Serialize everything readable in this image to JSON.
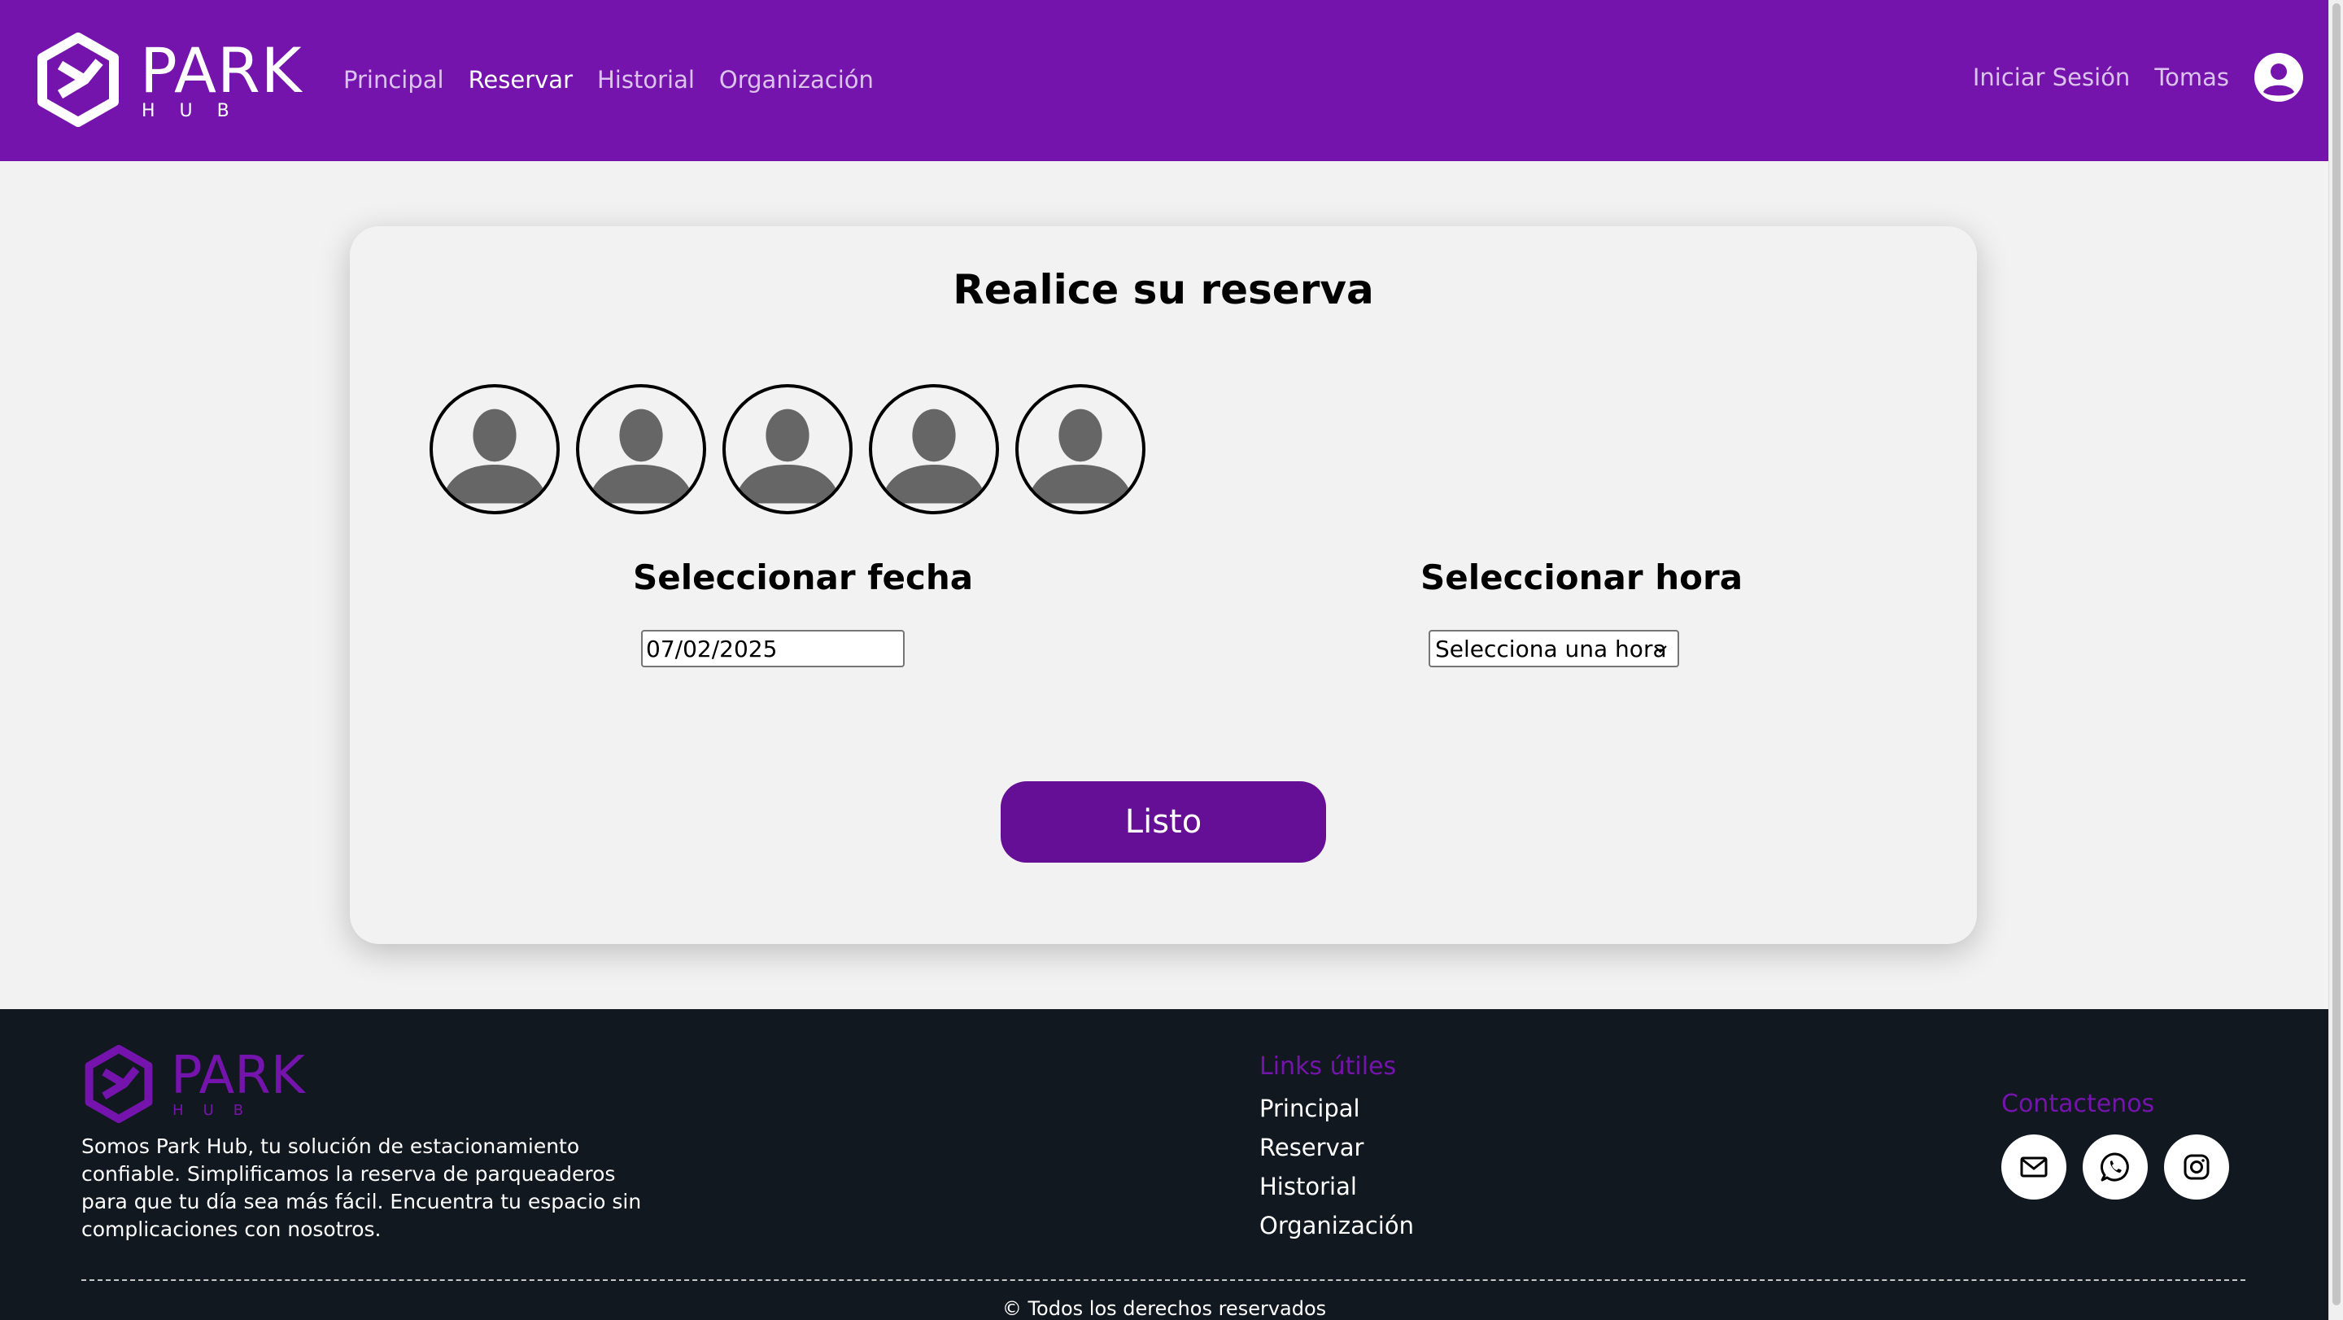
{
  "header": {
    "logo_word": "PARK",
    "logo_sub": "HUB",
    "nav": [
      {
        "label": "Principal",
        "active": false
      },
      {
        "label": "Reservar",
        "active": true
      },
      {
        "label": "Historial",
        "active": false
      },
      {
        "label": "Organización",
        "active": false
      }
    ],
    "login_label": "Iniciar Sesión",
    "user_name": "Tomas",
    "user_icon": "account-circle-icon"
  },
  "colors": {
    "brand": "#7514ac",
    "button": "#650f96",
    "footer_bg": "#111820",
    "page_bg": "#f2f2f2"
  },
  "reservation": {
    "title": "Realice su reserva",
    "avatar_icon": "person-placeholder-icon",
    "avatar_count": 5,
    "date_label": "Seleccionar fecha",
    "date_value": "07/02/2025",
    "time_label": "Seleccionar hora",
    "time_value": "Selecciona una hora",
    "submit_label": "Listo"
  },
  "footer": {
    "logo_word": "PARK",
    "logo_sub": "HUB",
    "description": "Somos Park Hub, tu solución de estacionamiento confiable. Simplificamos la reserva de parqueaderos para que tu día sea más fácil. Encuentra tu espacio sin complicaciones con nosotros.",
    "links_title": "Links útiles",
    "links": [
      "Principal",
      "Reservar",
      "Historial",
      "Organización"
    ],
    "contact_title": "Contactenos",
    "contact_icons": [
      "mail-icon",
      "whatsapp-icon",
      "instagram-icon"
    ],
    "copyright": "© Todos los derechos reservados"
  }
}
